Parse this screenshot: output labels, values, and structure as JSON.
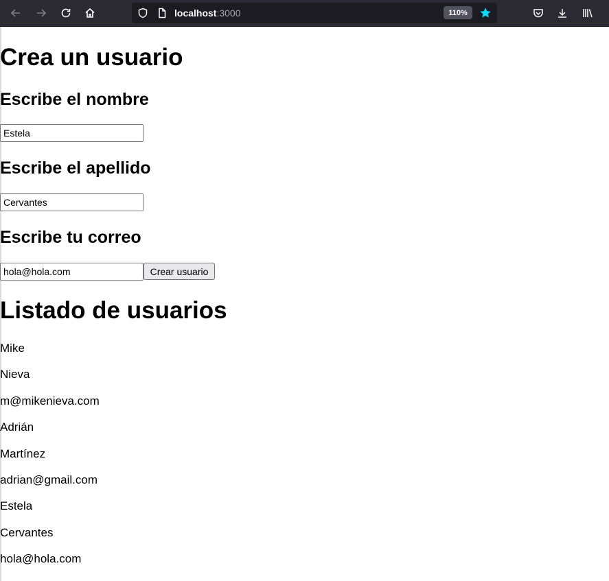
{
  "browser": {
    "url_host": "localhost",
    "url_port": ":3000",
    "zoom": "110%"
  },
  "form": {
    "title": "Crea un usuario",
    "name_label": "Escribe el nombre",
    "name_value": "Estela",
    "lastname_label": "Escribe el apellido",
    "lastname_value": "Cervantes",
    "email_label": "Escribe tu correo",
    "email_value": "hola@hola.com",
    "submit_label": "Crear usuario"
  },
  "list": {
    "title": "Listado de usuarios",
    "lines": [
      "Mike",
      "Nieva",
      "m@mikenieva.com",
      "Adrián",
      "Martínez",
      "adrian@gmail.com",
      "Estela",
      "Cervantes",
      "hola@hola.com"
    ]
  },
  "colors": {
    "toolbar_bg": "#2b2a33",
    "urlbar_bg": "#1c1b22",
    "star": "#00ddff"
  }
}
